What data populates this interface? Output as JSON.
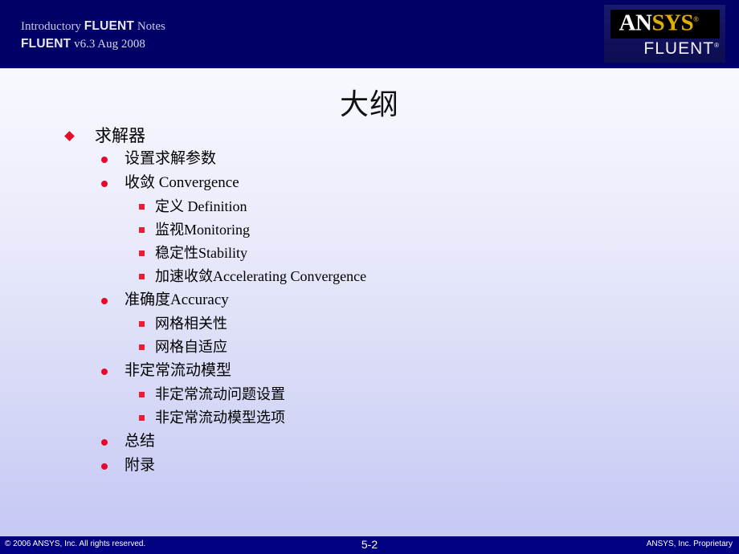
{
  "header": {
    "line1_part1": "Introductory ",
    "line1_part2": "FLUENT",
    "line1_part3": " Notes",
    "line2_part1": "FLUENT",
    "line2_part2": " v6.3  Aug 2008",
    "background_color": "#000066"
  },
  "logo": {
    "ansys_white": "AN",
    "ansys_gold": "SYS",
    "registered_mark": "®",
    "fluent": "FLUENT",
    "fluent_registered_mark": "®",
    "gold_color": "#e0b000",
    "plate_color": "#000000"
  },
  "title": {
    "text": "大纲"
  },
  "accent_colors": {
    "bullet_red": "#e8082c",
    "header_navy": "#000066",
    "footer_navy": "#000080",
    "background_top": "#fdfdff",
    "background_bottom": "#c5c8f3"
  },
  "outline": [
    {
      "level": 1,
      "bullet": "diamond",
      "text": "求解器"
    },
    {
      "level": 2,
      "bullet": "circle",
      "text": "设置求解参数"
    },
    {
      "level": 2,
      "bullet": "circle",
      "text": "收敛 Convergence"
    },
    {
      "level": 3,
      "bullet": "square",
      "text": "定义 Definition"
    },
    {
      "level": 3,
      "bullet": "square",
      "text": "监视Monitoring"
    },
    {
      "level": 3,
      "bullet": "square",
      "text": "稳定性Stability"
    },
    {
      "level": 3,
      "bullet": "square",
      "text": "加速收敛Accelerating Convergence"
    },
    {
      "level": 2,
      "bullet": "circle",
      "text": "准确度Accuracy"
    },
    {
      "level": 3,
      "bullet": "square",
      "text": "网格相关性"
    },
    {
      "level": 3,
      "bullet": "square",
      "text": "网格自适应"
    },
    {
      "level": 2,
      "bullet": "circle",
      "text": "非定常流动模型"
    },
    {
      "level": 3,
      "bullet": "square",
      "text": "非定常流动问题设置"
    },
    {
      "level": 3,
      "bullet": "square",
      "text": "非定常流动模型选项"
    },
    {
      "level": 2,
      "bullet": "circle",
      "text": "总结"
    },
    {
      "level": 2,
      "bullet": "circle",
      "text": "附录"
    }
  ],
  "footer": {
    "copyright": "© 2006 ANSYS, Inc.  All rights reserved.",
    "page_number": "5-2",
    "proprietary": "ANSYS, Inc. Proprietary"
  }
}
